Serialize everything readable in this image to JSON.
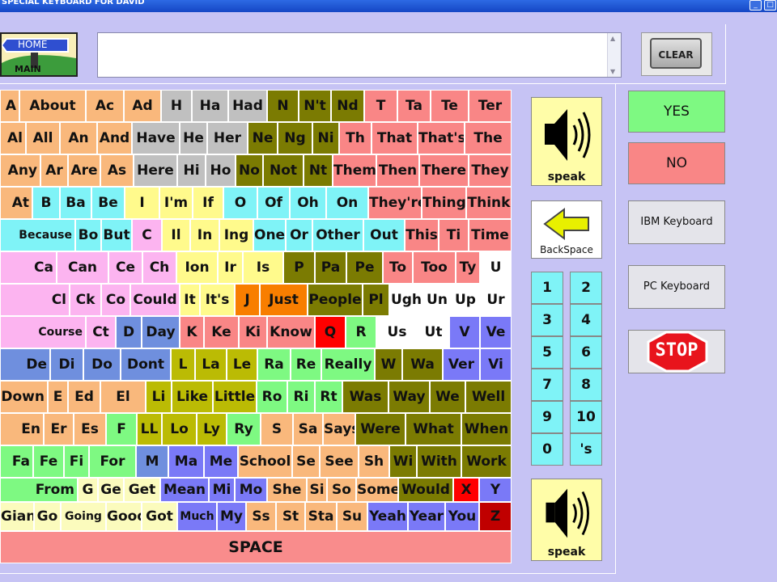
{
  "window": {
    "title": "SPECIAL KEYBOARD FOR DAVID"
  },
  "home": {
    "sign": "HOME",
    "label": "MAIN"
  },
  "clear_label": "CLEAR",
  "space_label": "SPACE",
  "speak_label": "speak",
  "backspace_label": "BackSpace",
  "yes_label": "YES",
  "no_label": "NO",
  "ibm_label": "IBM Keyboard",
  "pc_label": "PC Keyboard",
  "stop_label": "STOP",
  "colors": {
    "peach": "#f9b87c",
    "gray": "#c0c0c0",
    "olive": "#7b7b02",
    "salmon": "#f98686",
    "pink": "#fcb4f0",
    "cyan": "#7ff3f7",
    "yellow": "#fffa8c",
    "orange": "#f87e00",
    "red": "#ff0000",
    "green": "#7ef982",
    "white": "#ffffff",
    "blue": "#6f8fde",
    "purple": "#7a79f7",
    "lemon": "#fbfbbd",
    "yelgreen": "#bbbb04",
    "darkred": "#c00000",
    "lav": "#8d89f4"
  },
  "numbers": [
    "1",
    "2",
    "3",
    "4",
    "5",
    "6",
    "7",
    "8",
    "9",
    "10",
    "0",
    "'s"
  ],
  "rows": [
    [
      [
        "A",
        "peach"
      ],
      [
        "About",
        "peach"
      ],
      [
        "Ac",
        "peach"
      ],
      [
        "Ad",
        "peach"
      ],
      [
        "H",
        "gray"
      ],
      [
        "Ha",
        "gray"
      ],
      [
        "Had",
        "gray"
      ],
      [
        "N",
        "olive"
      ],
      [
        "N't",
        "olive"
      ],
      [
        "Nd",
        "olive"
      ],
      [
        "T",
        "salmon"
      ],
      [
        "Ta",
        "salmon"
      ],
      [
        "Te",
        "salmon"
      ],
      [
        "Ter",
        "salmon"
      ]
    ],
    [
      [
        "Al",
        "peach"
      ],
      [
        "All",
        "peach"
      ],
      [
        "An",
        "peach"
      ],
      [
        "And",
        "peach"
      ],
      [
        "Have",
        "gray"
      ],
      [
        "He",
        "gray"
      ],
      [
        "Her",
        "gray"
      ],
      [
        "Ne",
        "olive"
      ],
      [
        "Ng",
        "olive"
      ],
      [
        "Ni",
        "olive"
      ],
      [
        "Th",
        "salmon"
      ],
      [
        "That",
        "salmon"
      ],
      [
        "That's",
        "salmon"
      ],
      [
        "The",
        "salmon"
      ]
    ],
    [
      [
        "Any",
        "peach"
      ],
      [
        "Ar",
        "peach"
      ],
      [
        "Are",
        "peach"
      ],
      [
        "As",
        "peach"
      ],
      [
        "Here",
        "gray"
      ],
      [
        "Hi",
        "gray"
      ],
      [
        "Ho",
        "gray"
      ],
      [
        "No",
        "olive"
      ],
      [
        "Not",
        "olive"
      ],
      [
        "Nt",
        "olive"
      ],
      [
        "Them",
        "salmon"
      ],
      [
        "Then",
        "salmon"
      ],
      [
        "There",
        "salmon"
      ],
      [
        "They",
        "salmon"
      ]
    ],
    [
      [
        "At",
        "peach"
      ],
      [
        "B",
        "cyan"
      ],
      [
        "Ba",
        "cyan"
      ],
      [
        "Be",
        "cyan"
      ],
      [
        "I",
        "yellow"
      ],
      [
        "I'm",
        "yellow"
      ],
      [
        "If",
        "yellow"
      ],
      [
        "O",
        "cyan"
      ],
      [
        "Of",
        "cyan"
      ],
      [
        "Oh",
        "cyan"
      ],
      [
        "On",
        "cyan"
      ],
      [
        "They're",
        "salmon"
      ],
      [
        "Thing",
        "salmon"
      ],
      [
        "Think",
        "salmon"
      ]
    ],
    [
      [
        "Because",
        "cyan"
      ],
      [
        "Bo",
        "cyan"
      ],
      [
        "But",
        "cyan"
      ],
      [
        "C",
        "pink"
      ],
      [
        "Il",
        "yellow"
      ],
      [
        "In",
        "yellow"
      ],
      [
        "Ing",
        "yellow"
      ],
      [
        "One",
        "cyan"
      ],
      [
        "Or",
        "cyan"
      ],
      [
        "Other",
        "cyan"
      ],
      [
        "Out",
        "cyan"
      ],
      [
        "This",
        "salmon"
      ],
      [
        "Ti",
        "salmon"
      ],
      [
        "Time",
        "salmon"
      ]
    ],
    [
      [
        "Ca",
        "pink"
      ],
      [
        "Can",
        "pink"
      ],
      [
        "Ce",
        "pink"
      ],
      [
        "Ch",
        "pink"
      ],
      [
        "Ion",
        "yellow"
      ],
      [
        "Ir",
        "yellow"
      ],
      [
        "Is",
        "yellow"
      ],
      [
        "P",
        "olive"
      ],
      [
        "Pa",
        "olive"
      ],
      [
        "Pe",
        "olive"
      ],
      [
        "To",
        "salmon"
      ],
      [
        "Too",
        "salmon"
      ],
      [
        "Ty",
        "salmon"
      ],
      [
        "U",
        "white"
      ]
    ],
    [
      [
        "Cl",
        "pink"
      ],
      [
        "Ck",
        "pink"
      ],
      [
        "Co",
        "pink"
      ],
      [
        "Could",
        "pink"
      ],
      [
        "It",
        "yellow"
      ],
      [
        "It's",
        "yellow"
      ],
      [
        "J",
        "orange"
      ],
      [
        "Just",
        "orange"
      ],
      [
        "People",
        "olive"
      ],
      [
        "Pl",
        "olive"
      ],
      [
        "Ugh",
        "white"
      ],
      [
        "Un",
        "white"
      ],
      [
        "Up",
        "white"
      ],
      [
        "Ur",
        "white"
      ]
    ],
    [
      [
        "Course",
        "pink"
      ],
      [
        "Ct",
        "pink"
      ],
      [
        "D",
        "blue"
      ],
      [
        "Day",
        "blue"
      ],
      [
        "K",
        "salmon"
      ],
      [
        "Ke",
        "salmon"
      ],
      [
        "Ki",
        "salmon"
      ],
      [
        "Know",
        "salmon"
      ],
      [
        "Q",
        "red"
      ],
      [
        "R",
        "green"
      ],
      [
        "Us",
        "white"
      ],
      [
        "Ut",
        "white"
      ],
      [
        "V",
        "purple"
      ],
      [
        "Ve",
        "purple"
      ]
    ],
    [
      [
        "De",
        "blue"
      ],
      [
        "Di",
        "blue"
      ],
      [
        "Do",
        "blue"
      ],
      [
        "Dont",
        "blue"
      ],
      [
        "L",
        "yelgreen"
      ],
      [
        "La",
        "yelgreen"
      ],
      [
        "Le",
        "yelgreen"
      ],
      [
        "Ra",
        "green"
      ],
      [
        "Re",
        "green"
      ],
      [
        "Really",
        "green"
      ],
      [
        "W",
        "olive"
      ],
      [
        "Wa",
        "olive"
      ],
      [
        "Ver",
        "purple"
      ],
      [
        "Vi",
        "purple"
      ]
    ],
    [
      [
        "Down",
        "peach"
      ],
      [
        "E",
        "peach"
      ],
      [
        "Ed",
        "peach"
      ],
      [
        "El",
        "peach"
      ],
      [
        "Li",
        "yelgreen"
      ],
      [
        "Like",
        "yelgreen"
      ],
      [
        "Little",
        "yelgreen"
      ],
      [
        "Ro",
        "green"
      ],
      [
        "Ri",
        "green"
      ],
      [
        "Rt",
        "green"
      ],
      [
        "Was",
        "olive"
      ],
      [
        "Way",
        "olive"
      ],
      [
        "We",
        "olive"
      ],
      [
        "Well",
        "olive"
      ]
    ],
    [
      [
        "En",
        "peach"
      ],
      [
        "Er",
        "peach"
      ],
      [
        "Es",
        "peach"
      ],
      [
        "F",
        "green"
      ],
      [
        "LL",
        "yelgreen"
      ],
      [
        "Lo",
        "yelgreen"
      ],
      [
        "Ly",
        "yelgreen"
      ],
      [
        "Ry",
        "green"
      ],
      [
        "S",
        "peach"
      ],
      [
        "Sa",
        "peach"
      ],
      [
        "Says",
        "peach"
      ],
      [
        "Were",
        "olive"
      ],
      [
        "What",
        "olive"
      ],
      [
        "When",
        "olive"
      ]
    ],
    [
      [
        "Fa",
        "green"
      ],
      [
        "Fe",
        "green"
      ],
      [
        "Fi",
        "green"
      ],
      [
        "For",
        "green"
      ],
      [
        "M",
        "blue"
      ],
      [
        "Ma",
        "purple"
      ],
      [
        "Me",
        "purple"
      ],
      [
        "School",
        "peach"
      ],
      [
        "Se",
        "peach"
      ],
      [
        "See",
        "peach"
      ],
      [
        "Sh",
        "peach"
      ],
      [
        "Wi",
        "olive"
      ],
      [
        "With",
        "olive"
      ],
      [
        "Work",
        "olive"
      ]
    ],
    [
      [
        "From",
        "green"
      ],
      [
        "G",
        "lemon"
      ],
      [
        "Ge",
        "lemon"
      ],
      [
        "Get",
        "lemon"
      ],
      [
        "Mean",
        "purple"
      ],
      [
        "Mi",
        "purple"
      ],
      [
        "Mo",
        "purple"
      ],
      [
        "She",
        "peach"
      ],
      [
        "Si",
        "peach"
      ],
      [
        "So",
        "peach"
      ],
      [
        "Some",
        "peach"
      ],
      [
        "Would",
        "olive"
      ],
      [
        "X",
        "red"
      ],
      [
        "Y",
        "purple"
      ]
    ],
    [
      [
        "Giant",
        "lemon"
      ],
      [
        "Go",
        "lemon"
      ],
      [
        "Going",
        "lemon"
      ],
      [
        "Good",
        "lemon"
      ],
      [
        "Got",
        "lemon"
      ],
      [
        "Much",
        "purple"
      ],
      [
        "My",
        "purple"
      ],
      [
        "Ss",
        "peach"
      ],
      [
        "St",
        "peach"
      ],
      [
        "Sta",
        "peach"
      ],
      [
        "Su",
        "peach"
      ],
      [
        "Yeah",
        "purple"
      ],
      [
        "Year",
        "purple"
      ],
      [
        "You",
        "purple"
      ],
      [
        "Z",
        "darkred"
      ]
    ]
  ]
}
